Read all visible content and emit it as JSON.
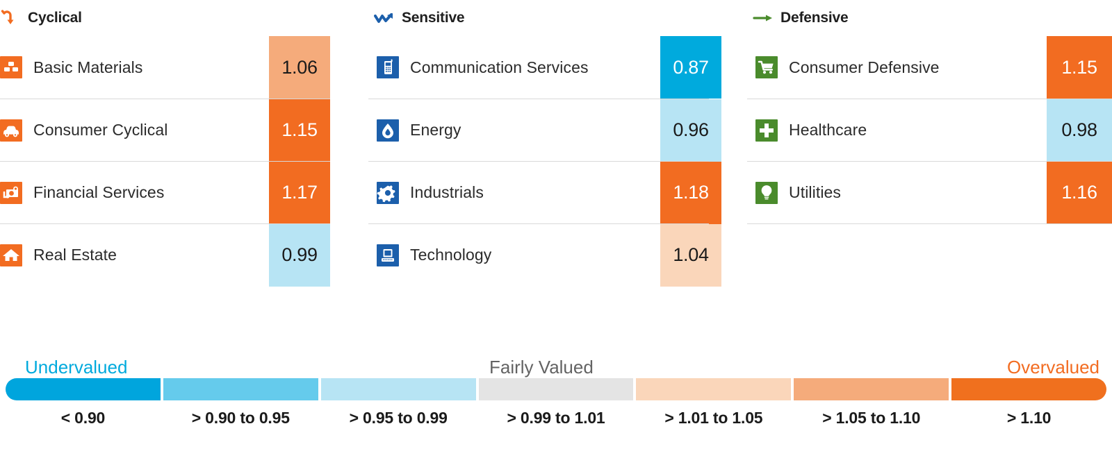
{
  "chart_data": {
    "type": "heatmap",
    "title": "",
    "description": "Sector price/fair value ratios grouped by super sector",
    "groups": [
      {
        "name": "Cyclical",
        "icon": "cyclical-arrow-icon",
        "accent": "#f26c21",
        "rows": [
          {
            "sector": "Basic Materials",
            "icon": "bricks-icon",
            "value": "1.06",
            "fill": "#f5ab7b",
            "text": "#1a1a1a"
          },
          {
            "sector": "Consumer Cyclical",
            "icon": "car-icon",
            "value": "1.15",
            "fill": "#f26c21",
            "text": "#ffffff"
          },
          {
            "sector": "Financial Services",
            "icon": "money-icon",
            "value": "1.17",
            "fill": "#f26c21",
            "text": "#ffffff"
          },
          {
            "sector": "Real Estate",
            "icon": "house-icon",
            "value": "0.99",
            "fill": "#b7e4f4",
            "text": "#1a1a1a"
          }
        ]
      },
      {
        "name": "Sensitive",
        "icon": "zigzag-arrow-icon",
        "accent": "#1c5fab",
        "rows": [
          {
            "sector": "Communication Services",
            "icon": "mobile-phone-icon",
            "value": "0.87",
            "fill": "#00aadd",
            "text": "#ffffff"
          },
          {
            "sector": "Energy",
            "icon": "flame-drop-icon",
            "value": "0.96",
            "fill": "#b7e4f4",
            "text": "#1a1a1a"
          },
          {
            "sector": "Industrials",
            "icon": "gear-icon",
            "value": "1.18",
            "fill": "#f26c21",
            "text": "#ffffff"
          },
          {
            "sector": "Technology",
            "icon": "computer-icon",
            "value": "1.04",
            "fill": "#fad6ba",
            "text": "#1a1a1a"
          }
        ]
      },
      {
        "name": "Defensive",
        "icon": "straight-arrow-icon",
        "accent": "#4a8b2c",
        "rows": [
          {
            "sector": "Consumer Defensive",
            "icon": "shopping-cart-icon",
            "value": "1.15",
            "fill": "#f26c21",
            "text": "#ffffff"
          },
          {
            "sector": "Healthcare",
            "icon": "medical-cross-icon",
            "value": "0.98",
            "fill": "#b7e4f4",
            "text": "#1a1a1a"
          },
          {
            "sector": "Utilities",
            "icon": "lightbulb-icon",
            "value": "1.16",
            "fill": "#f26c21",
            "text": "#ffffff"
          }
        ]
      }
    ],
    "legend": {
      "left_label": "Undervalued",
      "center_label": "Fairly Valued",
      "right_label": "Overvalued",
      "left_label_color": "#00aadd",
      "center_label_color": "#636363",
      "right_label_color": "#f26c21",
      "bins": [
        {
          "range": "< 0.90",
          "color": "#00a5dd"
        },
        {
          "range": "> 0.90 to 0.95",
          "color": "#65cbec"
        },
        {
          "range": "> 0.95 to 0.99",
          "color": "#b7e4f4"
        },
        {
          "range": "> 0.99 to 1.01",
          "color": "#e4e4e4"
        },
        {
          "range": "> 1.01 to 1.05",
          "color": "#fad6ba"
        },
        {
          "range": "> 1.05 to 1.10",
          "color": "#f5ab7b"
        },
        {
          "range": "> 1.10",
          "color": "#f0701e"
        }
      ]
    }
  }
}
